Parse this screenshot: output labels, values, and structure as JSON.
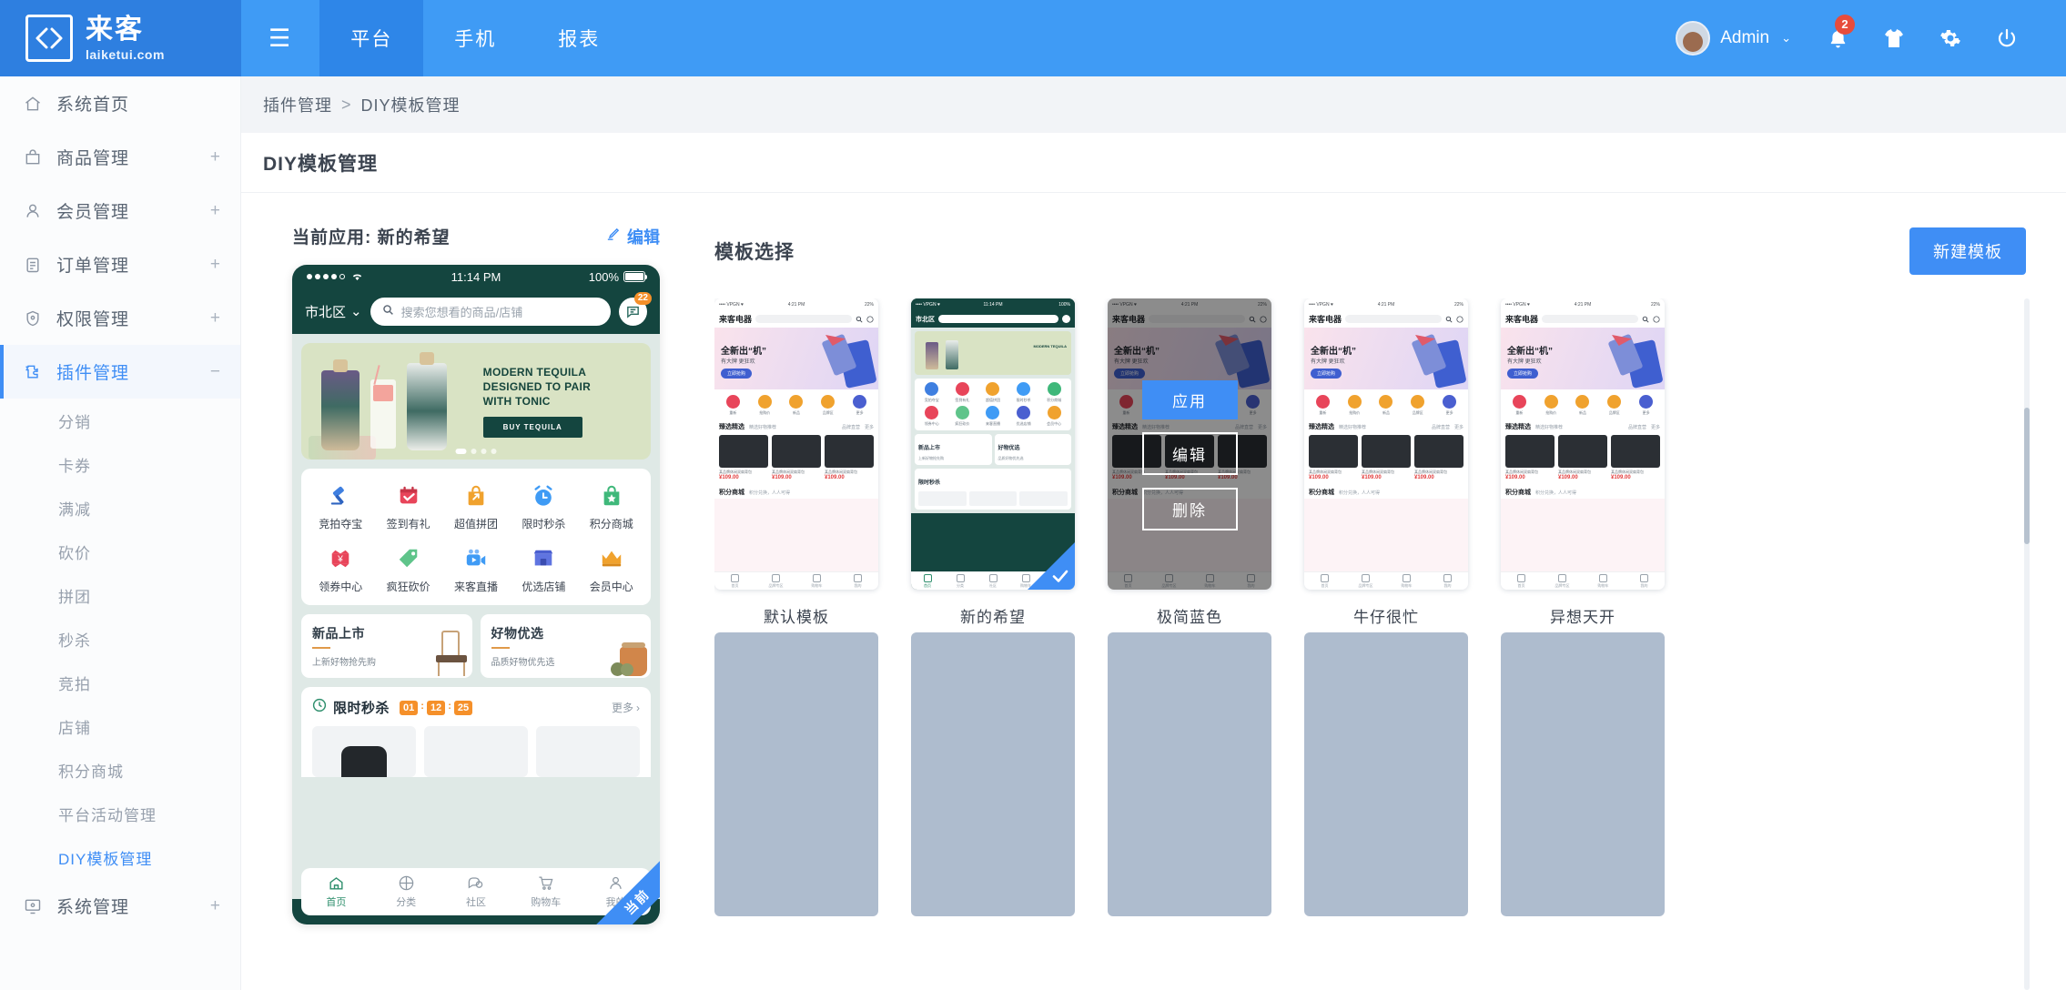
{
  "header": {
    "logo_cn": "来客",
    "logo_en": "laiketui.com",
    "nav": [
      {
        "label": "☰",
        "name": "menu-toggle",
        "active": false
      },
      {
        "label": "平台",
        "name": "nav-platform",
        "active": true
      },
      {
        "label": "手机",
        "name": "nav-mobile",
        "active": false
      },
      {
        "label": "报表",
        "name": "nav-reports",
        "active": false
      }
    ],
    "user": {
      "name": "Admin",
      "caret": "⌄"
    },
    "notification_count": "2",
    "icons": [
      "bell-icon",
      "shirt-icon",
      "gear-icon",
      "power-icon"
    ]
  },
  "sidebar": {
    "items": [
      {
        "label": "系统首页",
        "icon": "home-icon",
        "expand": "",
        "active": false
      },
      {
        "label": "商品管理",
        "icon": "bag-icon",
        "expand": "+",
        "active": false
      },
      {
        "label": "会员管理",
        "icon": "user-icon",
        "expand": "+",
        "active": false
      },
      {
        "label": "订单管理",
        "icon": "clipboard-icon",
        "expand": "+",
        "active": false
      },
      {
        "label": "权限管理",
        "icon": "shield-icon",
        "expand": "+",
        "active": false
      },
      {
        "label": "插件管理",
        "icon": "puzzle-icon",
        "expand": "−",
        "active": true
      }
    ],
    "sub_items": [
      {
        "label": "分销",
        "active": false
      },
      {
        "label": "卡券",
        "active": false
      },
      {
        "label": "满减",
        "active": false
      },
      {
        "label": "砍价",
        "active": false
      },
      {
        "label": "拼团",
        "active": false
      },
      {
        "label": "秒杀",
        "active": false
      },
      {
        "label": "竞拍",
        "active": false
      },
      {
        "label": "店铺",
        "active": false
      },
      {
        "label": "积分商城",
        "active": false
      },
      {
        "label": "平台活动管理",
        "active": false
      },
      {
        "label": "DIY模板管理",
        "active": true
      }
    ],
    "footer_item": {
      "label": "系统管理",
      "icon": "monitor-icon",
      "expand": "+"
    }
  },
  "breadcrumb": {
    "parent": "插件管理",
    "separator": ">",
    "current": "DIY模板管理"
  },
  "page_title": "DIY模板管理",
  "preview": {
    "current_label": "当前应用: 新的希望",
    "edit_label": "编辑",
    "status_bar": {
      "time": "11:14 PM",
      "battery": "100%"
    },
    "location": "市北区",
    "location_caret": "⌄",
    "search_placeholder": "搜索您想看的商品/店铺",
    "chat_badge": "22",
    "banner": {
      "line1": "MODERN TEQUILA",
      "line2": "DESIGNED TO PAIR",
      "line3": "WITH TONIC",
      "cta": "BUY TEQUILA"
    },
    "grid": [
      {
        "label": "竞拍夺宝",
        "icon": "gavel-icon",
        "color": "#3f7fe0"
      },
      {
        "label": "签到有礼",
        "icon": "calendar-icon",
        "color": "#e8455a"
      },
      {
        "label": "超值拼团",
        "icon": "group-bag-icon",
        "color": "#f0a22e"
      },
      {
        "label": "限时秒杀",
        "icon": "alarm-clock-icon",
        "color": "#3f9bf5"
      },
      {
        "label": "积分商城",
        "icon": "points-bag-icon",
        "color": "#3fb87a"
      },
      {
        "label": "领券中心",
        "icon": "coupon-icon",
        "color": "#e8455a"
      },
      {
        "label": "疯狂砍价",
        "icon": "tag-icon",
        "color": "#5fc48a"
      },
      {
        "label": "来客直播",
        "icon": "video-camera-icon",
        "color": "#3f9bf5"
      },
      {
        "label": "优选店铺",
        "icon": "store-icon",
        "color": "#4a5fd0"
      },
      {
        "label": "会员中心",
        "icon": "crown-icon",
        "color": "#f0a22e"
      }
    ],
    "cards": [
      {
        "title": "新品上市",
        "sub": "上新好物抢先购",
        "art": "chair"
      },
      {
        "title": "好物优选",
        "sub": "品质好物优先选",
        "art": "teapot"
      }
    ],
    "flash": {
      "title": "限时秒杀",
      "hours": "01",
      "minutes": "12",
      "seconds": "25",
      "colon": ":",
      "more": "更多",
      "more_caret": "›"
    },
    "tabbar": [
      {
        "label": "首页",
        "icon": "home-icon",
        "active": true
      },
      {
        "label": "分类",
        "icon": "category-icon",
        "active": false
      },
      {
        "label": "社区",
        "icon": "chat-icon",
        "active": false
      },
      {
        "label": "购物车",
        "icon": "cart-icon",
        "active": false
      },
      {
        "label": "我的",
        "icon": "person-icon",
        "active": false
      }
    ],
    "ribbon": "当前"
  },
  "templates": {
    "section_title": "模板选择",
    "new_button": "新建模板",
    "overlay_actions": [
      {
        "label": "应用",
        "style": "fill"
      },
      {
        "label": "编辑",
        "style": "out"
      },
      {
        "label": "删除",
        "style": "out"
      }
    ],
    "thumb_common": {
      "status_left": "•••• VPGN ♥",
      "status_time": "4:21 PM",
      "status_right": "22%",
      "brand": "来客电器",
      "hero_title": "全新出“机”",
      "hero_sub": "有大牌 更狂欢",
      "hero_btn": "立即抢购",
      "icons": [
        "重新",
        "抢购价",
        "新品",
        "品牌区",
        "更多"
      ],
      "section_title": "臻选精选",
      "section_sub": "精选好物推荐",
      "section_links": [
        "品牌直营",
        "更多"
      ],
      "product_name": "某品牌休闲双肩背包",
      "product_price": "¥109.00",
      "points_title": "积分商城",
      "points_sub": "积分兑换，人人可得",
      "foot": [
        "首页",
        "品牌专区",
        "购物车",
        "我的"
      ]
    },
    "items": [
      {
        "name": "默认模板",
        "theme": "light",
        "selected": false,
        "hovered": false
      },
      {
        "name": "新的希望",
        "theme": "green",
        "selected": true,
        "hovered": false
      },
      {
        "name": "极简蓝色",
        "theme": "dark",
        "selected": false,
        "hovered": true
      },
      {
        "name": "牛仔很忙",
        "theme": "light",
        "selected": false,
        "hovered": false
      },
      {
        "name": "异想天开",
        "theme": "light",
        "selected": false,
        "hovered": false
      }
    ],
    "skeleton_count": 5
  },
  "colors": {
    "brand_blue": "#3f9bf5",
    "accent_blue": "#3f8ef5",
    "badge_red": "#e74c3c",
    "phone_dark_green": "#14453f",
    "skeleton": "#aebcce"
  }
}
